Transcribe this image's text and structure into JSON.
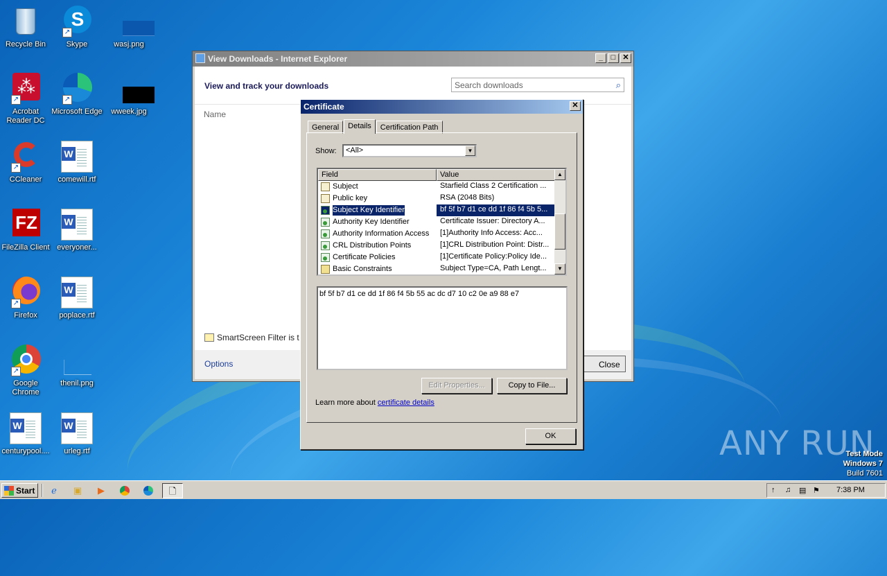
{
  "desktop": {
    "icons": [
      {
        "label": "Recycle Bin",
        "icon": "recycle-bin-icon"
      },
      {
        "label": "Skype",
        "icon": "skype-icon"
      },
      {
        "label": "wasj.png",
        "icon": "image-file-icon"
      },
      {
        "label": "Acrobat Reader DC",
        "icon": "acrobat-icon"
      },
      {
        "label": "Microsoft Edge",
        "icon": "edge-icon"
      },
      {
        "label": "wweek.jpg",
        "icon": "image-file-icon"
      },
      {
        "label": "CCleaner",
        "icon": "ccleaner-icon"
      },
      {
        "label": "comewill.rtf",
        "icon": "word-doc-icon"
      },
      {
        "label": "FileZilla Client",
        "icon": "filezilla-icon"
      },
      {
        "label": "everyoner...",
        "icon": "word-doc-icon"
      },
      {
        "label": "Firefox",
        "icon": "firefox-icon"
      },
      {
        "label": "poplace.rtf",
        "icon": "word-doc-icon"
      },
      {
        "label": "Google Chrome",
        "icon": "chrome-icon"
      },
      {
        "label": "thenil.png",
        "icon": "image-file-icon"
      },
      {
        "label": "centurypool....",
        "icon": "word-doc-icon"
      },
      {
        "label": "urleg.rtf",
        "icon": "word-doc-icon"
      }
    ]
  },
  "ie_window": {
    "title": "View Downloads - Internet Explorer",
    "header": "View and track your downloads",
    "search_placeholder": "Search downloads",
    "column_name": "Name",
    "smartscreen_text": "SmartScreen Filter is t",
    "options_label": "Options",
    "close_label": "Close"
  },
  "certificate": {
    "title": "Certificate",
    "tabs": [
      "General",
      "Details",
      "Certification Path"
    ],
    "active_tab": "Details",
    "show_label": "Show:",
    "show_value": "<All>",
    "columns": [
      "Field",
      "Value"
    ],
    "rows": [
      {
        "field": "Subject",
        "value": "Starfield Class 2 Certification ...",
        "icon": "cert-field-icon"
      },
      {
        "field": "Public key",
        "value": "RSA (2048 Bits)",
        "icon": "cert-field-icon"
      },
      {
        "field": "Subject Key Identifier",
        "value": "bf 5f b7 d1 ce dd 1f 86 f4 5b 5...",
        "icon": "cert-extension-icon",
        "selected": true
      },
      {
        "field": "Authority Key Identifier",
        "value": "Certificate Issuer: Directory A...",
        "icon": "cert-extension-icon"
      },
      {
        "field": "Authority Information Access",
        "value": "[1]Authority Info Access: Acc...",
        "icon": "cert-extension-icon"
      },
      {
        "field": "CRL Distribution Points",
        "value": "[1]CRL Distribution Point: Distr...",
        "icon": "cert-extension-icon"
      },
      {
        "field": "Certificate Policies",
        "value": "[1]Certificate Policy:Policy Ide...",
        "icon": "cert-extension-icon"
      },
      {
        "field": "Basic Constraints",
        "value": "Subject Type=CA, Path Lengt...",
        "icon": "cert-critical-icon"
      }
    ],
    "detail_value": "bf 5f b7 d1 ce dd 1f 86 f4 5b 55 ac dc d7 10 c2 0e a9 88 e7",
    "edit_properties_label": "Edit Properties...",
    "copy_to_file_label": "Copy to File...",
    "learn_more_text": "Learn more about ",
    "learn_more_link": "certificate details",
    "ok_label": "OK"
  },
  "watermark": "ANY RUN",
  "test_mode": {
    "line1": "Test Mode",
    "line2": "Windows 7",
    "line3": "Build 7601"
  },
  "taskbar": {
    "start_label": "Start",
    "clock": "7:38 PM",
    "pinned": [
      "ie-icon",
      "explorer-icon",
      "media-player-icon",
      "chrome-icon",
      "edge-icon",
      "document-icon"
    ]
  }
}
